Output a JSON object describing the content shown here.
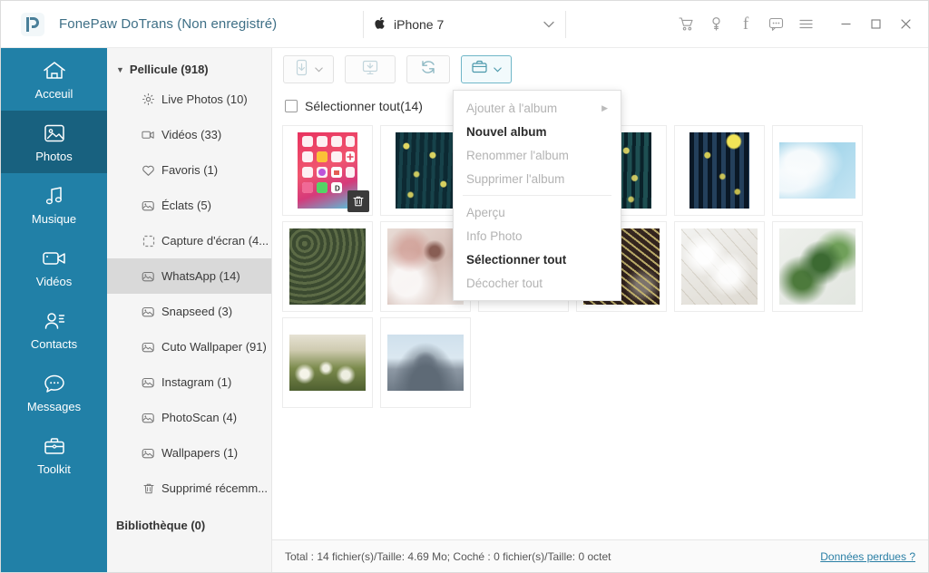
{
  "window": {
    "title": "FonePaw DoTrans (Non enregistré)",
    "logo_icon": "fonepaw-logo-icon",
    "accent_color": "#2180a7",
    "title_color": "#3e6f86"
  },
  "device": {
    "brand_icon": "apple-icon",
    "name": "iPhone 7",
    "chevron_icon": "chevron-down-icon"
  },
  "titlebar_icons": [
    {
      "name": "cart-icon",
      "label": "Panier"
    },
    {
      "name": "key-icon",
      "label": "Clé d'enregistrement"
    },
    {
      "name": "facebook-icon",
      "label": "f"
    },
    {
      "name": "feedback-icon",
      "label": "Commentaires"
    },
    {
      "name": "menu-icon",
      "label": "Menu"
    }
  ],
  "window_controls": [
    {
      "name": "minimize-button",
      "glyph": "—"
    },
    {
      "name": "maximize-button",
      "glyph": "□"
    },
    {
      "name": "close-button",
      "glyph": "✕"
    }
  ],
  "sidebar": {
    "items": [
      {
        "label": "Acceuil",
        "icon": "home-icon",
        "active": false
      },
      {
        "label": "Photos",
        "icon": "photo-icon",
        "active": true
      },
      {
        "label": "Musique",
        "icon": "music-icon",
        "active": false
      },
      {
        "label": "Vidéos",
        "icon": "video-icon",
        "active": false
      },
      {
        "label": "Contacts",
        "icon": "contacts-icon",
        "active": false
      },
      {
        "label": "Messages",
        "icon": "message-icon",
        "active": false
      },
      {
        "label": "Toolkit",
        "icon": "toolkit-icon",
        "active": false
      }
    ]
  },
  "tree": {
    "root": {
      "label": "Pellicule (918)",
      "caret": "▼"
    },
    "children": [
      {
        "label": "Live Photos (10)",
        "icon": "live-photos-icon",
        "selected": false
      },
      {
        "label": "Vidéos (33)",
        "icon": "video-icon",
        "selected": false
      },
      {
        "label": "Favoris (1)",
        "icon": "heart-icon",
        "selected": false
      },
      {
        "label": "Éclats (5)",
        "icon": "album-icon",
        "selected": false
      },
      {
        "label": "Capture d'écran (4...",
        "icon": "screenshot-icon",
        "selected": false
      },
      {
        "label": "WhatsApp (14)",
        "icon": "album-icon",
        "selected": true
      },
      {
        "label": "Snapseed (3)",
        "icon": "album-icon",
        "selected": false
      },
      {
        "label": "Cuto Wallpaper (91)",
        "icon": "album-icon",
        "selected": false
      },
      {
        "label": "Instagram (1)",
        "icon": "album-icon",
        "selected": false
      },
      {
        "label": "PhotoScan (4)",
        "icon": "album-icon",
        "selected": false
      },
      {
        "label": "Wallpapers (1)",
        "icon": "album-icon",
        "selected": false
      },
      {
        "label": "Supprimé récemm...",
        "icon": "trash-icon",
        "selected": false
      }
    ],
    "library": "Bibliothèque (0)"
  },
  "toolbar": {
    "buttons": [
      {
        "name": "add-to-device-button",
        "icon": "phone-import-icon",
        "has_caret": true,
        "active": false
      },
      {
        "name": "export-to-pc-button",
        "icon": "monitor-export-icon",
        "has_caret": false,
        "active": false
      },
      {
        "name": "refresh-button",
        "icon": "refresh-icon",
        "has_caret": false,
        "active": false
      },
      {
        "name": "album-menu-button",
        "icon": "briefcase-icon",
        "has_caret": true,
        "active": true
      }
    ]
  },
  "select_all": {
    "label": "Sélectionner tout(14)",
    "checked": false
  },
  "menu": {
    "items": [
      {
        "label": "Ajouter à l'album",
        "enabled": false,
        "submenu": true
      },
      {
        "label": "Nouvel album",
        "enabled": true,
        "submenu": false
      },
      {
        "label": "Renommer l'album",
        "enabled": false,
        "submenu": false
      },
      {
        "label": "Supprimer l'album",
        "enabled": false,
        "submenu": false
      },
      {
        "separator": true
      },
      {
        "label": "Aperçu",
        "enabled": false,
        "submenu": false
      },
      {
        "label": "Info Photo",
        "enabled": false,
        "submenu": false
      },
      {
        "label": "Sélectionner tout",
        "enabled": true,
        "submenu": false
      },
      {
        "label": "Décocher tout",
        "enabled": false,
        "submenu": false
      }
    ]
  },
  "grid": {
    "photos": [
      {
        "name": "ios-home-screen-screenshot",
        "shape": "portrait",
        "hovered": true,
        "overlay_icon": "trash-icon",
        "palette": [
          "#e8325f",
          "#f05070",
          "#d63a7a",
          "#50c8e0"
        ]
      },
      {
        "name": "fireflies-forest-1",
        "shape": "portrait",
        "hovered": false,
        "palette": [
          "#12363f",
          "#1c4a4a",
          "#0d2a33",
          "#e8dc60"
        ]
      },
      {
        "name": "fireflies-forest-2",
        "shape": "portrait",
        "hovered": false,
        "palette": [
          "#14303c",
          "#1b4550",
          "#0c252e",
          "#e6d85a"
        ]
      },
      {
        "name": "fireflies-forest-3",
        "shape": "portrait",
        "hovered": false,
        "palette": [
          "#12363f",
          "#1e4f52",
          "#0a222a",
          "#ece16a"
        ]
      },
      {
        "name": "fireflies-moon-forest",
        "shape": "portrait",
        "hovered": false,
        "palette": [
          "#13283d",
          "#24405c",
          "#0a1826",
          "#f2e457"
        ]
      },
      {
        "name": "white-blossom-blue-sky",
        "shape": "landscape",
        "hovered": false,
        "palette": [
          "#8ecbe4",
          "#bcdff0",
          "#f4f8fa",
          "#d8e9f2"
        ]
      },
      {
        "name": "pine-forest-aerial",
        "shape": "portrait",
        "hovered": false,
        "palette": [
          "#4a5a3c",
          "#3b4a30",
          "#5c6b46",
          "#2e3a24"
        ]
      },
      {
        "name": "blossom-insect-macro",
        "shape": "portrait",
        "hovered": false,
        "palette": [
          "#e8dcd6",
          "#d8c4bc",
          "#c8a89e",
          "#f2ecea"
        ]
      },
      {
        "name": "green-leaves-bokeh",
        "shape": "landscape",
        "hovered": false,
        "palette": [
          "#2d5a2a",
          "#4a7c3c",
          "#e8f0e6",
          "#1e4020"
        ]
      },
      {
        "name": "golden-grass-macro",
        "shape": "portrait",
        "hovered": false,
        "palette": [
          "#3a2a22",
          "#9a8a4a",
          "#c8b870",
          "#2a1c18"
        ]
      },
      {
        "name": "white-blossom-bright",
        "shape": "portrait",
        "hovered": false,
        "palette": [
          "#f0f0ee",
          "#e2e2e0",
          "#d8d4cc",
          "#fafafa"
        ]
      },
      {
        "name": "green-leaves-white-bg",
        "shape": "portrait",
        "hovered": false,
        "palette": [
          "#e8eae6",
          "#3c6a32",
          "#70a05a",
          "#f4f6f2"
        ]
      },
      {
        "name": "dandelion-field",
        "shape": "portrait",
        "hovered": false,
        "palette": [
          "#d8d2c2",
          "#8a8a5a",
          "#5a6a3a",
          "#eceade"
        ]
      },
      {
        "name": "government-building",
        "shape": "portrait",
        "hovered": false,
        "palette": [
          "#c8d4de",
          "#8a95a2",
          "#6a7480",
          "#e2e8ee"
        ]
      }
    ]
  },
  "status": {
    "text": "Total : 14 fichier(s)/Taille: 4.69 Mo; Coché : 0 fichier(s)/Taille: 0 octet",
    "link": "Données perdues ?",
    "link_color": "#2a7fa5"
  }
}
